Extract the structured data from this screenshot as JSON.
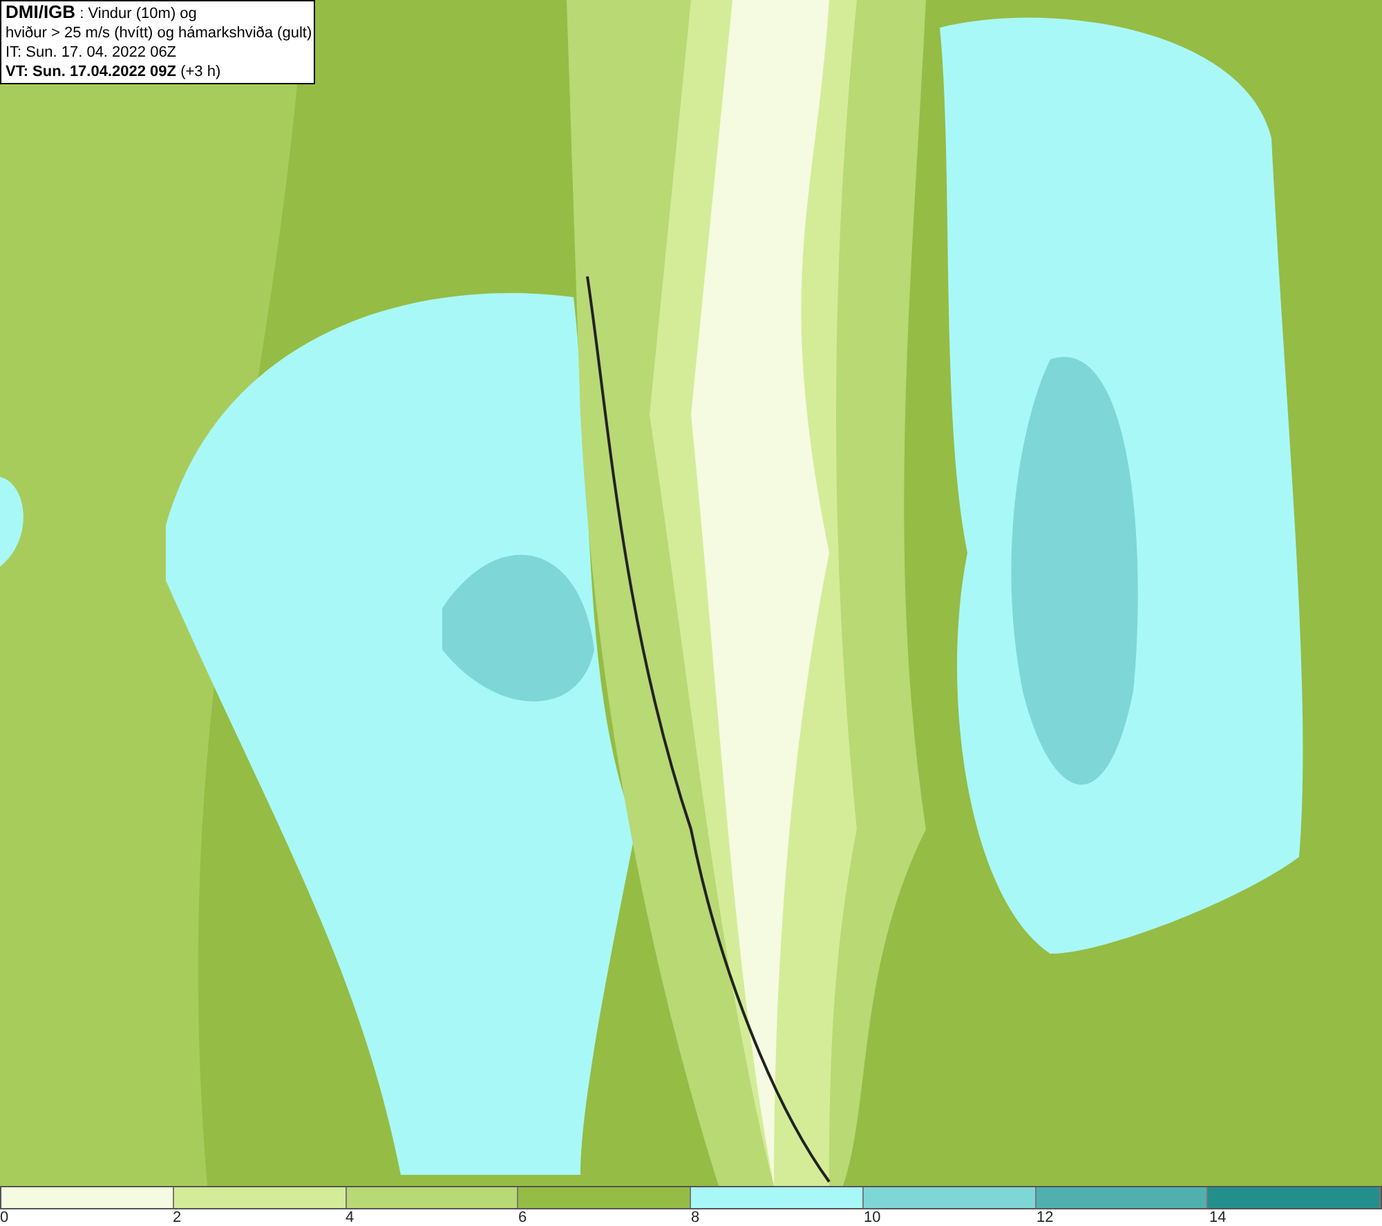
{
  "header": {
    "lines": [
      "**DMI/IGB** : Vindur (10m) og",
      "hviður > 25 m/s (hvítt) og hámarkshviða (gult)",
      "IT: Sun. 17. 04. 2022 06Z",
      "**VT: Sun. 17.04.2022 09Z** (+3 h)"
    ]
  },
  "legend": {
    "bins": [
      {
        "color": "#f4fbe0"
      },
      {
        "color": "#d4ec98"
      },
      {
        "color": "#b8d974"
      },
      {
        "color": "#95bc44"
      },
      {
        "color": "#a8f8f8"
      },
      {
        "color": "#7fd6d6"
      },
      {
        "color": "#50b0b0"
      },
      {
        "color": "#238f8c"
      }
    ],
    "ticks": [
      "0",
      "2",
      "4",
      "6",
      "8",
      "10",
      "12",
      "14"
    ]
  }
}
